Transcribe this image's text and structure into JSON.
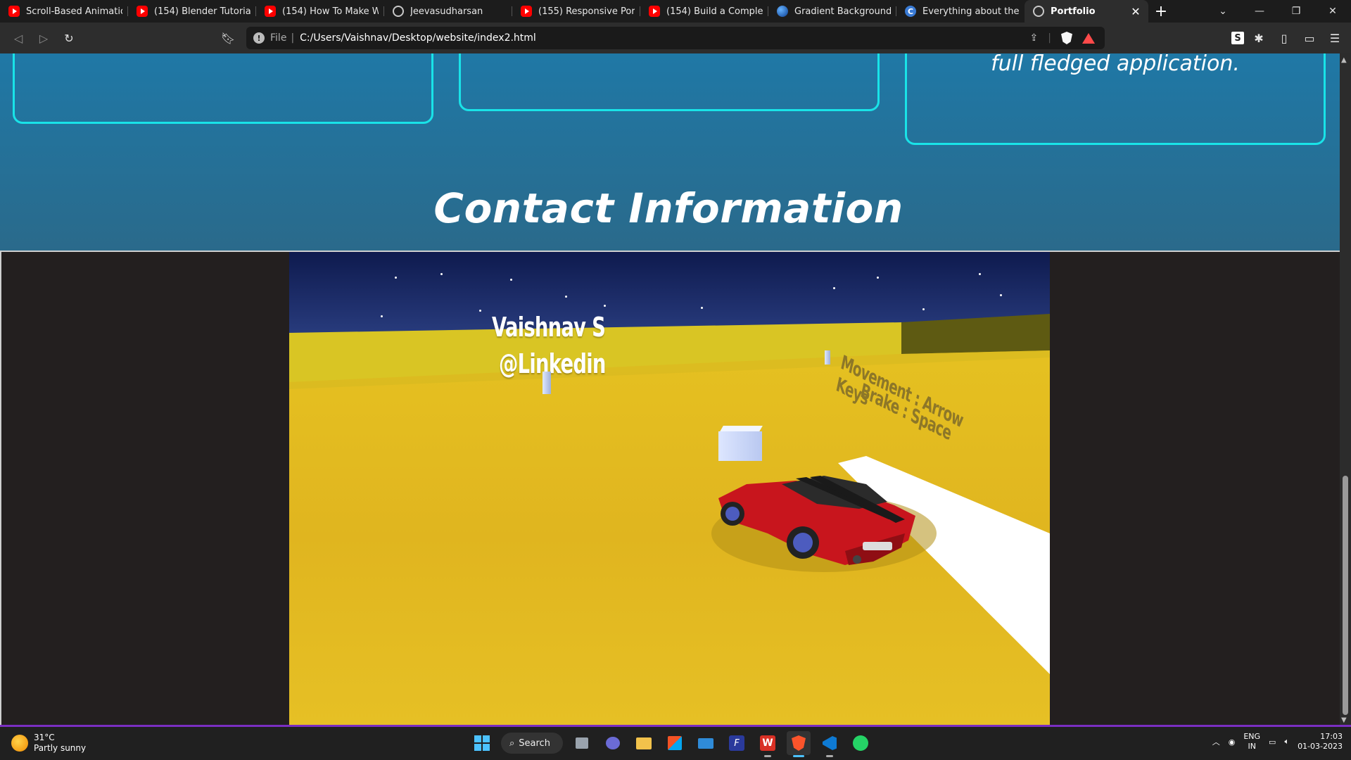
{
  "browser": {
    "tabs": [
      {
        "title": "Scroll-Based Animation",
        "icon": "youtube-icon"
      },
      {
        "title": "(154) Blender Tutorial -",
        "icon": "youtube-icon"
      },
      {
        "title": "(154) How To Make We",
        "icon": "youtube-icon"
      },
      {
        "title": "Jeevasudharsan",
        "icon": "globe-icon"
      },
      {
        "title": "(155) Responsive Portfo",
        "icon": "youtube-icon"
      },
      {
        "title": "(154) Build a Complete",
        "icon": "youtube-icon"
      },
      {
        "title": "Gradient Backgrounds",
        "icon": "gradient-icon"
      },
      {
        "title": "Everything about the c",
        "icon": "c-icon"
      },
      {
        "title": "Portfolio",
        "icon": "globe-icon",
        "active": true
      }
    ],
    "new_tab": "+",
    "address": {
      "scheme_label": "File",
      "url": "C:/Users/Vaishnav/Desktop/website/index2.html"
    },
    "extension_badge": "S"
  },
  "page": {
    "card_partial_text": "full fledged application.",
    "section_title": "Contact Information",
    "game": {
      "billboard_name": "Vaishnav S",
      "billboard_link": "@Linkedin",
      "controls_movement": "Movement : Arrow Keys",
      "controls_brake": "Brake : Space"
    }
  },
  "taskbar": {
    "weather_temp": "31°C",
    "weather_desc": "Partly sunny",
    "search_label": "Search",
    "lang_top": "ENG",
    "lang_bottom": "IN",
    "time": "17:03",
    "date": "01-03-2023"
  },
  "colors": {
    "accent_cyan": "#19e3e8",
    "site_blue": "#1f78a6",
    "ground_yellow": "#e6c025",
    "car_red": "#c8151d"
  }
}
